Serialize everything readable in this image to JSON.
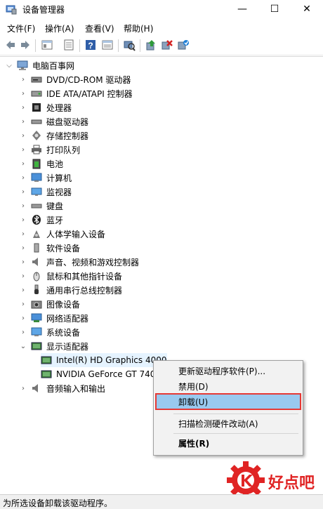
{
  "window": {
    "title": "设备管理器",
    "minimize": "—",
    "maximize": "☐",
    "close": "✕"
  },
  "menu": [
    "文件(F)",
    "操作(A)",
    "查看(V)",
    "帮助(H)"
  ],
  "tree": {
    "root": "电脑百事网",
    "categories": [
      {
        "label": "DVD/CD-ROM 驱动器",
        "icon": "dvd-drive-icon"
      },
      {
        "label": "IDE ATA/ATAPI 控制器",
        "icon": "ide-controller-icon"
      },
      {
        "label": "处理器",
        "icon": "processor-icon"
      },
      {
        "label": "磁盘驱动器",
        "icon": "disk-drive-icon"
      },
      {
        "label": "存储控制器",
        "icon": "storage-controller-icon"
      },
      {
        "label": "打印队列",
        "icon": "printer-icon"
      },
      {
        "label": "电池",
        "icon": "battery-icon"
      },
      {
        "label": "计算机",
        "icon": "computer-icon"
      },
      {
        "label": "监视器",
        "icon": "monitor-icon"
      },
      {
        "label": "键盘",
        "icon": "keyboard-icon"
      },
      {
        "label": "蓝牙",
        "icon": "bluetooth-icon"
      },
      {
        "label": "人体学输入设备",
        "icon": "hid-icon"
      },
      {
        "label": "软件设备",
        "icon": "software-device-icon"
      },
      {
        "label": "声音、视频和游戏控制器",
        "icon": "speaker-icon"
      },
      {
        "label": "鼠标和其他指针设备",
        "icon": "mouse-icon"
      },
      {
        "label": "通用串行总线控制器",
        "icon": "usb-icon"
      },
      {
        "label": "图像设备",
        "icon": "camera-icon"
      },
      {
        "label": "网络适配器",
        "icon": "network-adapter-icon"
      },
      {
        "label": "系统设备",
        "icon": "system-device-icon"
      },
      {
        "label": "显示适配器",
        "icon": "display-adapter-icon"
      }
    ],
    "display_children": [
      "Intel(R) HD Graphics 4000",
      "NVIDIA GeForce GT 740"
    ],
    "last_category": "音频输入和输出"
  },
  "context_menu": {
    "items": [
      "更新驱动程序软件(P)...",
      "禁用(D)",
      "卸载(U)",
      "扫描检测硬件改动(A)",
      "属性(R)"
    ],
    "highlight_color": "#99c9ef",
    "highlight_border": "#e53935"
  },
  "status": "为所选设备卸载该驱动程序。",
  "watermark": {
    "text": "好点吧"
  }
}
